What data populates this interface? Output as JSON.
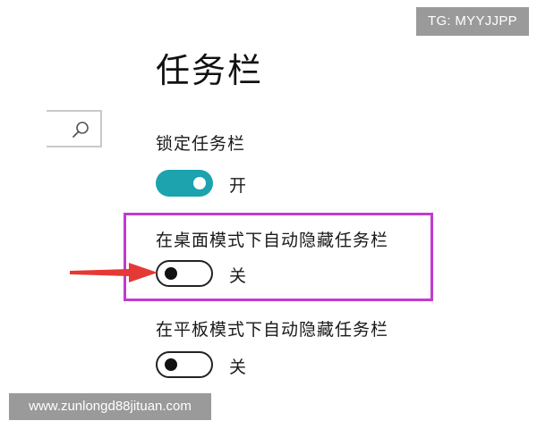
{
  "badge": {
    "text": "TG: MYYJJPP"
  },
  "page": {
    "title": "任务栏"
  },
  "search": {
    "icon": "search-icon"
  },
  "settings": [
    {
      "label": "锁定任务栏",
      "state": "开",
      "on": true
    },
    {
      "label": "在桌面模式下自动隐藏任务栏",
      "state": "关",
      "on": false
    },
    {
      "label": "在平板模式下自动隐藏任务栏",
      "state": "关",
      "on": false
    }
  ],
  "colors": {
    "toggle_on": "#1ca3ad",
    "highlight": "#c13bd1",
    "arrow": "#e53935"
  },
  "watermark": {
    "text": "www.zunlongd88jituan.com"
  }
}
